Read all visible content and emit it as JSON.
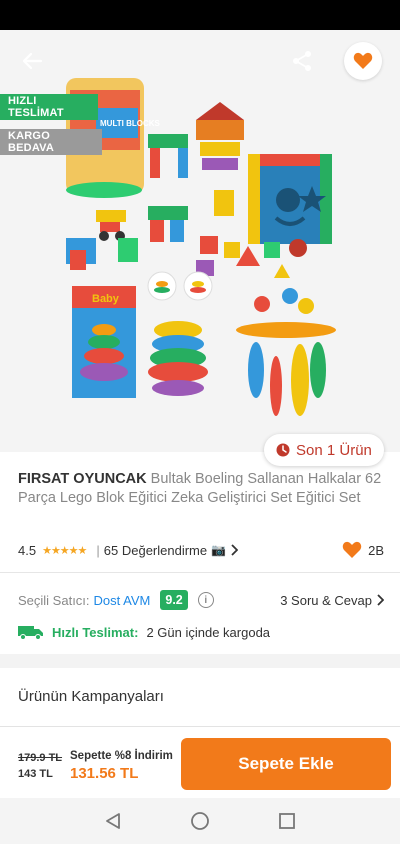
{
  "badges": {
    "fast": "HIZLI TESLİMAT",
    "free": "KARGO BEDAVA"
  },
  "hero": {
    "toy_box_text": "MULTI BLOCKS",
    "stacker_box_text": "Baby"
  },
  "stock": {
    "label": "Son 1 Ürün"
  },
  "product": {
    "brand": "FIRSAT OYUNCAK",
    "title": "Bultak Boeling Sallanan Halkalar 62 Parça Lego Blok Eğitici Zeka Geliştirici Set Eğitici Set"
  },
  "rating": {
    "score": "4.5",
    "stars": "★★★★★",
    "review_count": "65 Değerlendirme",
    "likes": "2B"
  },
  "seller": {
    "label": "Seçili Satıcı:",
    "name": "Dost AVM",
    "score": "9.2",
    "qa_link": "3 Soru & Cevap"
  },
  "delivery": {
    "label": "Hızlı Teslimat:",
    "text": "2 Gün içinde kargoda"
  },
  "campaigns": {
    "title": "Ürünün Kampanyaları"
  },
  "pricing": {
    "old_price": "179.9 TL",
    "base_price": "143 TL",
    "cart_discount": "Sepette %8 İndirim",
    "final_price": "131.56 TL"
  },
  "actions": {
    "add_to_cart": "Sepete Ekle"
  },
  "colors": {
    "brand_orange": "#f27a1a",
    "green": "#27ae60",
    "seller_blue": "#1e88e5",
    "stock_red": "#c0392b"
  },
  "icons": {
    "back": "arrow-left-icon",
    "share": "share-icon",
    "favorite": "heart-icon",
    "clock": "clock-icon",
    "camera": "camera-icon",
    "chevron": "chevron-right-icon",
    "info": "info-icon",
    "truck": "truck-icon",
    "nav_back": "triangle-back-icon",
    "nav_home": "circle-home-icon",
    "nav_recent": "square-recent-icon"
  }
}
